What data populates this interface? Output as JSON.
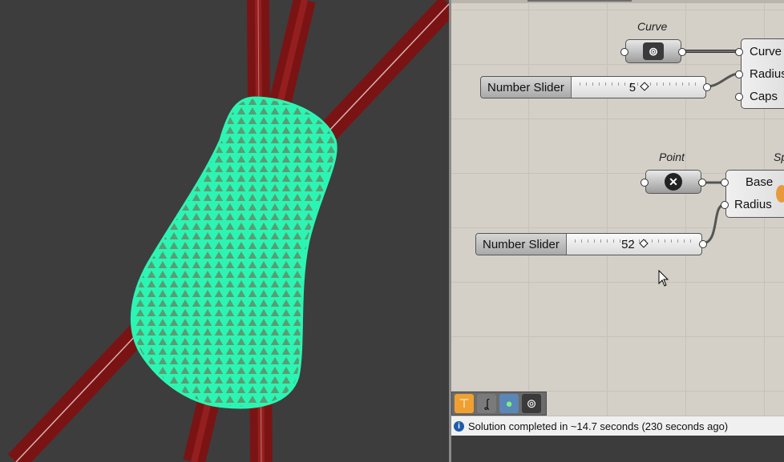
{
  "canvas": {
    "curve_component": {
      "title": "Curve",
      "icon": "curve-param-icon"
    },
    "pipe_component": {
      "inputs": [
        "Curve",
        "Radius",
        "Caps"
      ]
    },
    "slider_radius": {
      "label": "Number Slider",
      "value": "5"
    },
    "point_component": {
      "title": "Point",
      "icon": "point-param-icon"
    },
    "sphere_component": {
      "title": "Sp",
      "inputs": [
        "Base",
        "Radius"
      ]
    },
    "slider_sphere_radius": {
      "label": "Number Slider",
      "value": "52"
    }
  },
  "toolbar": {
    "buttons": [
      "preview-icon",
      "hook-icon",
      "render-icon",
      "curve-icon"
    ]
  },
  "status": {
    "message": "Solution completed in ~14.7 seconds (230 seconds ago)"
  },
  "colors": {
    "mesh": "#2cf5b3",
    "pipes": "#8b1a1a",
    "viewport_bg": "#3d3d3d",
    "canvas_bg": "#d4d0c8"
  }
}
